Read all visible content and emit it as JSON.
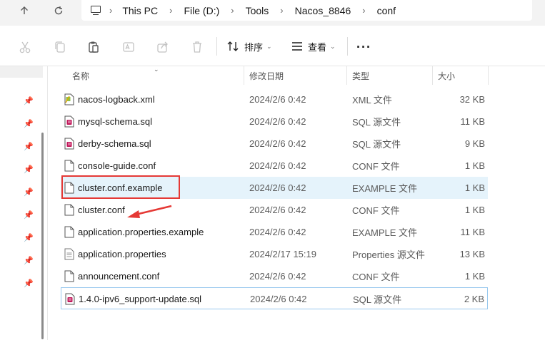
{
  "address_bar": {
    "crumbs": [
      "This PC",
      "File (D:)",
      "Tools",
      "Nacos_8846",
      "conf"
    ]
  },
  "toolbar": {
    "sort_label": "排序",
    "view_label": "查看",
    "more_label": "···"
  },
  "columns": {
    "name": "名称",
    "date": "修改日期",
    "type": "类型",
    "size": "大小"
  },
  "files": [
    {
      "name": "nacos-logback.xml",
      "date": "2024/2/6 0:42",
      "type": "XML 文件",
      "size": "32 KB",
      "icon": "xml-file-icon"
    },
    {
      "name": "mysql-schema.sql",
      "date": "2024/2/6 0:42",
      "type": "SQL 源文件",
      "size": "11 KB",
      "icon": "sql-file-icon"
    },
    {
      "name": "derby-schema.sql",
      "date": "2024/2/6 0:42",
      "type": "SQL 源文件",
      "size": "9 KB",
      "icon": "sql-file-icon"
    },
    {
      "name": "console-guide.conf",
      "date": "2024/2/6 0:42",
      "type": "CONF 文件",
      "size": "1 KB",
      "icon": "blank-file-icon"
    },
    {
      "name": "cluster.conf.example",
      "date": "2024/2/6 0:42",
      "type": "EXAMPLE 文件",
      "size": "1 KB",
      "icon": "blank-file-icon"
    },
    {
      "name": "cluster.conf",
      "date": "2024/2/6 0:42",
      "type": "CONF 文件",
      "size": "1 KB",
      "icon": "blank-file-icon"
    },
    {
      "name": "application.properties.example",
      "date": "2024/2/6 0:42",
      "type": "EXAMPLE 文件",
      "size": "11 KB",
      "icon": "blank-file-icon"
    },
    {
      "name": "application.properties",
      "date": "2024/2/17 15:19",
      "type": "Properties 源文件",
      "size": "13 KB",
      "icon": "properties-file-icon"
    },
    {
      "name": "announcement.conf",
      "date": "2024/2/6 0:42",
      "type": "CONF 文件",
      "size": "1 KB",
      "icon": "blank-file-icon"
    },
    {
      "name": "1.4.0-ipv6_support-update.sql",
      "date": "2024/2/6 0:42",
      "type": "SQL 源文件",
      "size": "2 KB",
      "icon": "sql-file-icon"
    }
  ],
  "colors": {
    "highlight_box": "#e53935",
    "selected_row": "#e5f3fb",
    "focus_border": "#99c9ee"
  }
}
